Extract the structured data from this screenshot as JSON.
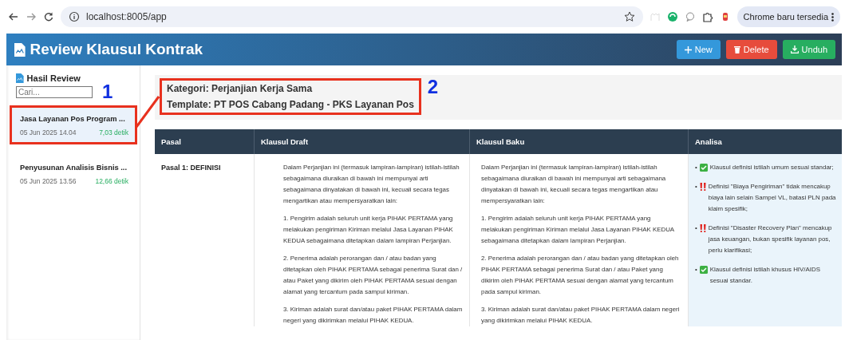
{
  "browser": {
    "url": "localhost:8005/app",
    "update_button": "Chrome baru tersedia"
  },
  "header": {
    "title": "Review Klausul Kontrak",
    "buttons": [
      {
        "label": "New",
        "kind": "new"
      },
      {
        "label": "Delete",
        "kind": "delete"
      },
      {
        "label": "Unduh",
        "kind": "download"
      }
    ]
  },
  "sidebar": {
    "title": "Hasil Review",
    "search": {
      "placeholder": "Cari..."
    },
    "items": [
      {
        "title": "Jasa Layanan Pos Program ...",
        "date": "05 Jun 2025 14.04",
        "duration": "7,03 detik",
        "selected": true,
        "annotated": true
      },
      {
        "title": "Penyusunan Analisis Bisnis ...",
        "date": "05 Jun 2025 13.56",
        "duration": "12,66 detik",
        "selected": false,
        "annotated": false
      }
    ]
  },
  "annotations": [
    {
      "label": "1"
    },
    {
      "label": "2"
    }
  ],
  "meta": {
    "category": "Kategori: Perjanjian Kerja Sama",
    "template": "Template: PT POS Cabang Padang - PKS Layanan Pos",
    "annotated": true
  },
  "table": {
    "columns": [
      "Pasal",
      "Klausul Draft",
      "Klausul Baku",
      "Analisa"
    ],
    "rows": [
      {
        "pasal": "Pasal 1: DEFINISI",
        "draft": [
          "Dalam Perjanjian ini (termasuk lampiran-lampiran) istilah-istilah sebagaimana diuraikan di bawah ini mempunyai arti sebagaimana dinyatakan di bawah ini, kecuali secara tegas mengartikan atau mempersyaratkan lain:",
          "1. Pengirim adalah seluruh unit kerja PIHAK PERTAMA yang melakukan pengiriman Kiriman melalui Jasa Layanan PIHAK KEDUA sebagaimana ditetapkan dalam lampiran Perjanjian.",
          "2. Penerima adalah perorangan dan / atau badan yang ditetapkan oleh PIHAK PERTAMA sebagai penerima Surat dan / atau Paket yang dikirim oleh PIHAK PERTAMA sesuai dengan alamat yang tercantum pada sampul kiriman.",
          "3. Kiriman adalah surat dan/atau paket PIHAK PERTAMA dalam negeri yang dikirimkan melalui PIHAK KEDUA."
        ],
        "baku": [
          "Dalam Perjanjian ini (termasuk lampiran-lampiran) istilah-istilah sebagaimana diuraikan di bawah ini mempunyai arti sebagaimana dinyatakan di bawah ini, kecuali secara tegas mengartikan atau mempersyaratkan lain:",
          "1. Pengirim adalah seluruh unit kerja PIHAK PERTAMA yang melakukan pengiriman Kiriman melalui Jasa Layanan PIHAK KEDUA sebagaimana ditetapkan dalam lampiran Perjanjian.",
          "2. Penerima adalah perorangan dan / atau badan yang ditetapkan oleh PIHAK PERTAMA sebagai penerima Surat dan / atau Paket yang dikirim oleh PIHAK PERTAMA sesuai dengan alamat yang tercantum pada sampul kiriman.",
          "3. Kiriman adalah surat dan/atau paket PIHAK PERTAMA dalam negeri yang dikirimkan melalui PIHAK KEDUA."
        ],
        "analysis": [
          {
            "bullet": "•",
            "kind": "ok",
            "text": "Klausul definisi istilah umum sesuai standar;"
          },
          {
            "bullet": "•",
            "kind": "warn",
            "text": "Definisi \"Biaya Pengiriman\" tidak mencakup biaya lain selain Sampel VL, batasi PLN pada klaim spesifik;"
          },
          {
            "bullet": "•",
            "kind": "warn",
            "text": "Definisi \"Disaster Recovery Plan\" mencakup jasa keuangan, bukan spesifik layanan pos, perlu klarifikasi;"
          },
          {
            "bullet": "•",
            "kind": "ok",
            "text": "Klausul definisi istilah khusus HIV/AIDS sesuai standar."
          }
        ]
      }
    ]
  }
}
